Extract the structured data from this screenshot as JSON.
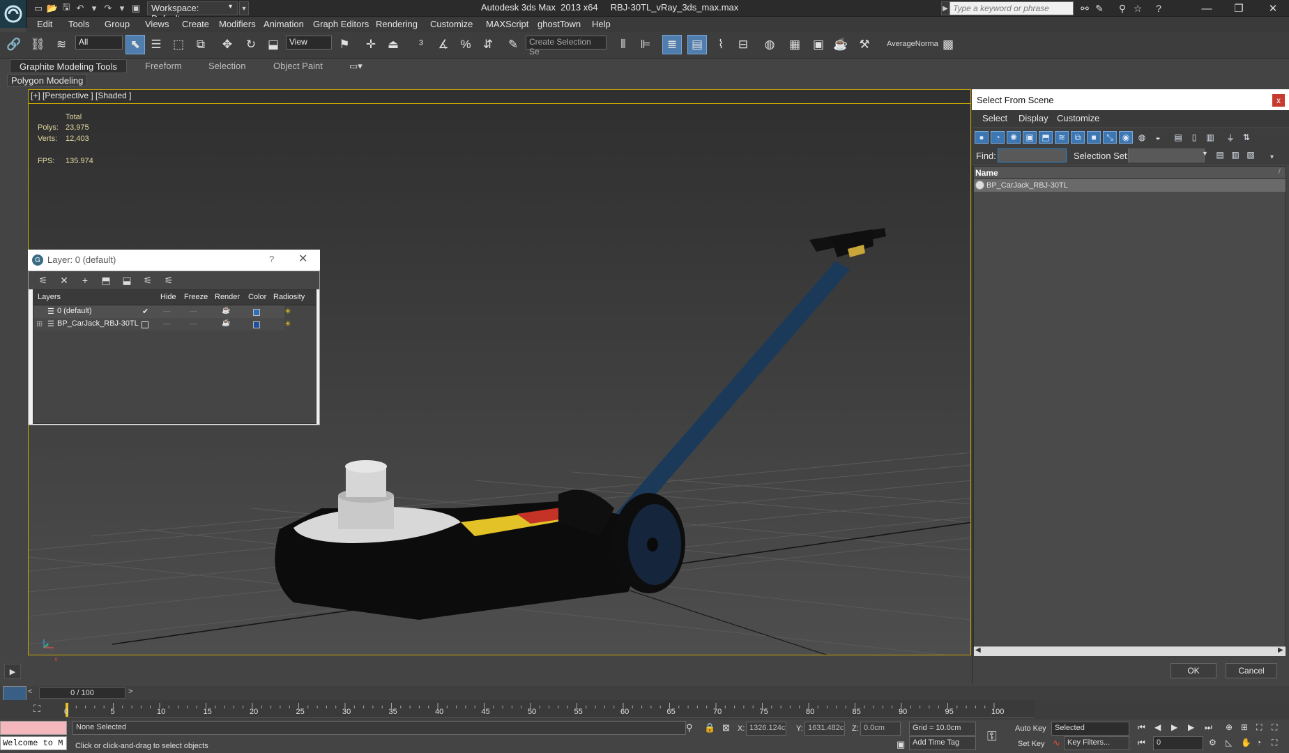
{
  "window": {
    "app_title": "Autodesk 3ds Max  2013 x64",
    "file_name": "RBJ-30TL_vRay_3ds_max.max",
    "workspace_value": "Workspace: Default",
    "search_placeholder": "Type a keyword or phrase"
  },
  "menu": [
    "Edit",
    "Tools",
    "Group",
    "Views",
    "Create",
    "Modifiers",
    "Animation",
    "Graph Editors",
    "Rendering",
    "Customize",
    "MAXScript",
    "ghostTown",
    "Help"
  ],
  "toolbar": {
    "selection_filter": "All",
    "ref_coord": "View",
    "selection_set_placeholder": "Create Selection Se",
    "average_normals": "AverageNorma"
  },
  "ribbon": {
    "tabs": [
      "Graphite Modeling Tools",
      "Freeform",
      "Selection",
      "Object Paint"
    ],
    "panel": "Polygon Modeling"
  },
  "viewport": {
    "label": "[+] [Perspective ] [Shaded ]",
    "stats_header": "Total",
    "polys_label": "Polys:",
    "polys_value": "23,975",
    "verts_label": "Verts:",
    "verts_value": "12,403",
    "fps_label": "FPS:",
    "fps_value": "135.974",
    "axis_z": "z",
    "axis_x": "x"
  },
  "layer_dialog": {
    "title": "Layer: 0 (default)",
    "help": "?",
    "columns": [
      "Layers",
      "Hide",
      "Freeze",
      "Render",
      "Color",
      "Radiosity"
    ],
    "rows": [
      {
        "name": "0 (default)",
        "active": true,
        "color": "#2f6fb6"
      },
      {
        "name": "BP_CarJack_RBJ-30TL",
        "active": false,
        "color": "#1f4f9e"
      }
    ],
    "separator": "----"
  },
  "select_from_scene": {
    "title": "Select From Scene",
    "menu": [
      "Select",
      "Display",
      "Customize"
    ],
    "find_label": "Find:",
    "find_value": "",
    "selection_set_label": "Selection Set:",
    "name_header": "Name",
    "items": [
      "BP_CarJack_RBJ-30TL"
    ],
    "ok": "OK",
    "cancel": "Cancel"
  },
  "timeline": {
    "frame": "0 / 100",
    "ticks": [
      "0",
      "5",
      "10",
      "15",
      "20",
      "25",
      "30",
      "35",
      "40",
      "45",
      "50",
      "55",
      "60",
      "65",
      "70",
      "75",
      "80",
      "85",
      "90",
      "95",
      "100"
    ]
  },
  "status": {
    "listener": "Welcome to M",
    "selection": "None Selected",
    "prompt": "Click or click-and-drag to select objects",
    "x_label": "X:",
    "x_value": "1326.124c",
    "y_label": "Y:",
    "y_value": "1631.482c",
    "z_label": "Z:",
    "z_value": "0.0cm",
    "grid": "Grid = 10.0cm",
    "add_time_tag": "Add Time Tag",
    "auto_key": "Auto Key",
    "set_key": "Set Key",
    "key_mode": "Selected",
    "key_filters": "Key Filters...",
    "current_frame": "0"
  }
}
